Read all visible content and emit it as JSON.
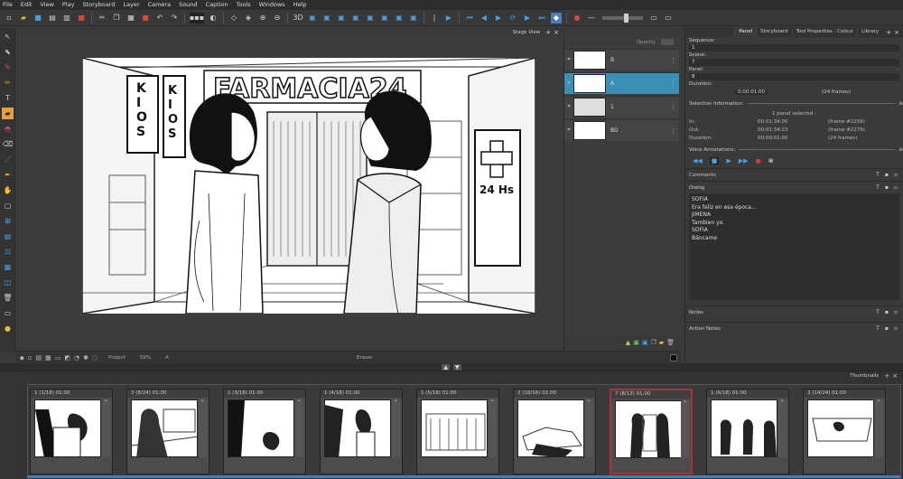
{
  "menu": [
    "File",
    "Edit",
    "View",
    "Play",
    "Storyboard",
    "Layer",
    "Camera",
    "Sound",
    "Caption",
    "Tools",
    "Windows",
    "Help"
  ],
  "stage": {
    "view_label": "Stage View",
    "bottom": {
      "mode": "Project",
      "zoom": "59%",
      "layer": "A",
      "tool": "Eraser"
    }
  },
  "layers": {
    "opacity_label": "Opacity",
    "items": [
      {
        "name": "B"
      },
      {
        "name": "A",
        "selected": true
      },
      {
        "name": "1"
      },
      {
        "name": "BG"
      }
    ]
  },
  "panel": {
    "tabs": [
      "Panel",
      "Storyboard",
      "Tool Properties : Colour",
      "Library"
    ],
    "sequence_label": "Sequence:",
    "sequence_value": "1",
    "scene_label": "Scene:",
    "scene_value": "7",
    "panel_label": "Panel:",
    "panel_value": "8",
    "duration_label": "Duration:",
    "duration_value": "0:00:01:00",
    "duration_frames": "(24 frames)",
    "selection_header": "Selection Information:",
    "selection_count": "1 panel selected :",
    "sel_rows": [
      {
        "label": "In:",
        "time": "00:01:34:00",
        "frame": "(frame #2256)"
      },
      {
        "label": "Out:",
        "time": "00:01:34:23",
        "frame": "(frame #2279)"
      },
      {
        "label": "Duration:",
        "time": "00:00:01:00",
        "frame": "(24 frames)"
      }
    ],
    "voice_header": "Voice Annotations:",
    "comments_label": "Comments",
    "dialog_label": "Dialog",
    "dialog_lines": [
      "SOFIA",
      "Era feliz en esa época...",
      "JIMENA",
      "Tambien yo.",
      "SOFIA",
      "Báncame"
    ],
    "notes_label": "Notes",
    "action_notes_label": "Action Notes"
  },
  "timeline": {
    "title": "Thumbnails",
    "thumbs": [
      {
        "label": "1 (1/18) 01:00"
      },
      {
        "label": "3 (8/24) 01:00"
      },
      {
        "label": "1 (3/18) 01:00"
      },
      {
        "label": "1 (4/18) 01:00"
      },
      {
        "label": "1 (5/18) 01:00"
      },
      {
        "label": "2 (16/16) 01:00"
      },
      {
        "label": "7 (8/13) 01:00",
        "selected": true
      },
      {
        "label": "1 (6/18) 01:00"
      },
      {
        "label": "3 (14/24) 01:00"
      }
    ]
  },
  "scene": {
    "sign_text": "FARMACIA24",
    "kiosk_text": "KIOSCO",
    "hours_text": "24 Hs"
  }
}
